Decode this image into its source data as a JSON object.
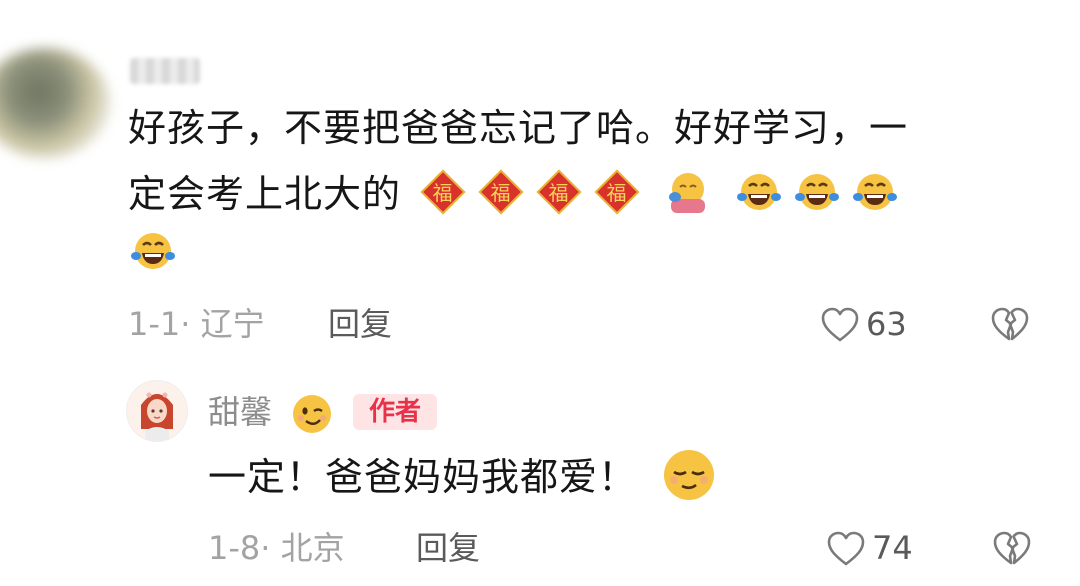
{
  "comment": {
    "line1": "好孩子，不要把爸爸忘记了哈。好好学习，一",
    "line2": "定会考上北大的",
    "fu_char": "福",
    "date": "1-1·",
    "location": "辽宁",
    "reply_label": "回复",
    "like_count": "63"
  },
  "reply": {
    "author": "甜馨",
    "badge": "作者",
    "text": "一定！爸爸妈妈我都爱！",
    "date": "1-8·",
    "location": "北京",
    "reply_label": "回复",
    "like_count": "74"
  },
  "icons": {
    "like": "heart-outline-icon",
    "dislike": "broken-heart-icon",
    "fu": "fu-blessing-emoji",
    "hug": "hug-emoji",
    "laugh": "tears-of-joy-emoji",
    "wink": "wink-emoji",
    "smirk": "content-smile-emoji"
  },
  "colors": {
    "badge_bg": "#ffe4e6",
    "badge_text": "#e8324a",
    "meta_text": "#a3a3a3"
  }
}
